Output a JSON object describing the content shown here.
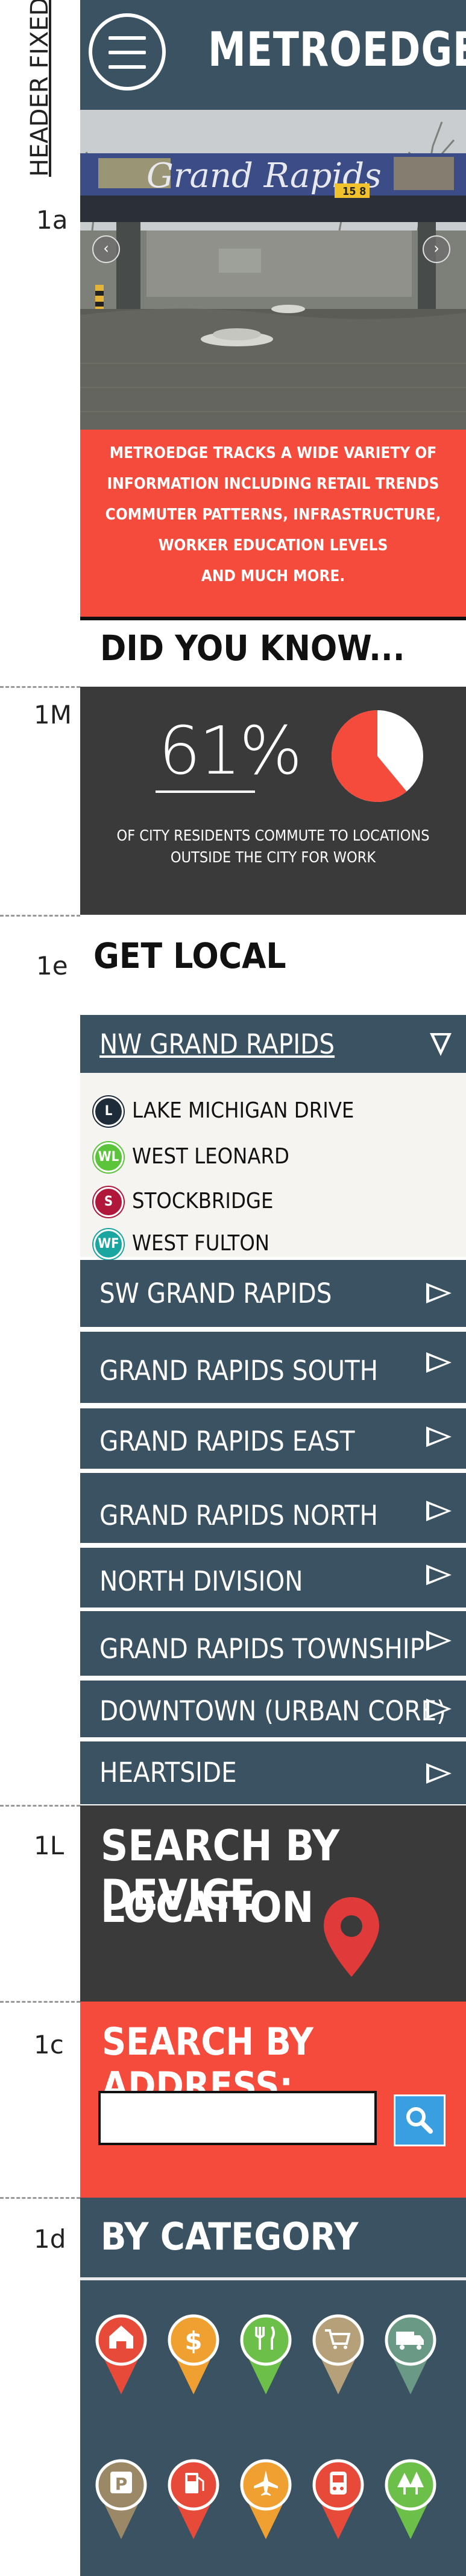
{
  "annotations": {
    "header_label": "HEADER FIXED",
    "s1a": "1a",
    "s1m": "1M",
    "s1e": "1e",
    "s1l": "1L",
    "s1c": "1c",
    "s1d": "1d"
  },
  "header": {
    "brand": "METROEDGE",
    "menu_icon": "hamburger-menu-icon"
  },
  "hero": {
    "sign_text": "Grand Rapids",
    "intro_lines": [
      "METROEDGE TRACKS A WIDE VARIETY OF",
      "INFORMATION INCLUDING RETAIL TRENDS",
      "COMMUTER PATTERNS, INFRASTRUCTURE,",
      "WORKER EDUCATION LEVELS",
      "AND MUCH MORE."
    ]
  },
  "did_you_know": {
    "heading": "DID YOU KNOW...",
    "percent_text": "61%",
    "percent_value": 61,
    "caption_1": "OF CITY RESIDENTS COMMUTE TO LOCATIONS",
    "caption_2": "OUTSIDE THE CITY FOR WORK",
    "pie_color": "#f44b3d"
  },
  "get_local": {
    "heading": "GET LOCAL",
    "expanded": {
      "label": "NW GRAND RAPIDS",
      "items": [
        {
          "label": "LAKE MICHIGAN DRIVE",
          "badge": "L",
          "color": "#1e2c3a"
        },
        {
          "label": "WEST LEONARD",
          "badge": "WL",
          "color": "#5bc43a"
        },
        {
          "label": "STOCKBRIDGE",
          "badge": "S",
          "color": "#b0173a"
        },
        {
          "label": "WEST FULTON",
          "badge": "WF",
          "color": "#1aa6a0"
        }
      ]
    },
    "regions": [
      "SW GRAND RAPIDS",
      "GRAND RAPIDS SOUTH",
      "GRAND RAPIDS EAST",
      "GRAND RAPIDS NORTH",
      "NORTH DIVISION",
      "GRAND RAPIDS TOWNSHIP",
      "DOWNTOWN (URBAN CORE)",
      "HEARTSIDE"
    ]
  },
  "geo": {
    "line1": "SEARCH BY DEVICE",
    "line2": "LOCATION",
    "pin_color": "#e03a3a"
  },
  "address": {
    "heading": "SEARCH BY ADDRESS:",
    "value": "",
    "button_color": "#3a9fe0"
  },
  "category": {
    "heading": "BY CATEGORY",
    "pins": [
      {
        "name": "home",
        "color": "#e84a3a"
      },
      {
        "name": "money",
        "color": "#f0a030"
      },
      {
        "name": "dining",
        "color": "#6cc04a"
      },
      {
        "name": "shopping",
        "color": "#b5a07a"
      },
      {
        "name": "delivery",
        "color": "#6a9a85"
      },
      {
        "name": "parking",
        "color": "#9a8866"
      },
      {
        "name": "fuel",
        "color": "#e84a3a"
      },
      {
        "name": "airport",
        "color": "#f0a030"
      },
      {
        "name": "transit",
        "color": "#e84a3a"
      },
      {
        "name": "parks",
        "color": "#6cc04a"
      }
    ]
  }
}
